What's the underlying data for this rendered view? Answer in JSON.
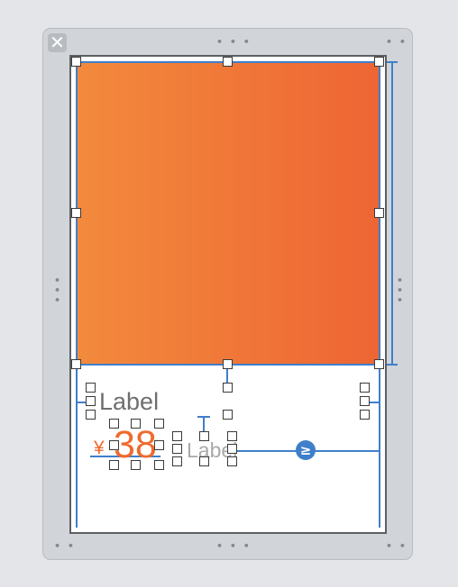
{
  "canvas": {
    "close_glyph": "✕",
    "resize_dots": "• • •",
    "corner_dots": "• •",
    "side_dots": "•\n•\n•"
  },
  "cell": {
    "title_label": "Label",
    "currency_symbol": "¥",
    "price_label": "38",
    "secondary_label": "Label",
    "constraint_relation": "≥"
  },
  "colors": {
    "image_gradient_start": "#f28a3c",
    "image_gradient_end": "#ee6534",
    "accent_orange": "#ef6a2e",
    "constraint_blue": "#3f7fca",
    "label_gray": "#6f6f6f"
  }
}
